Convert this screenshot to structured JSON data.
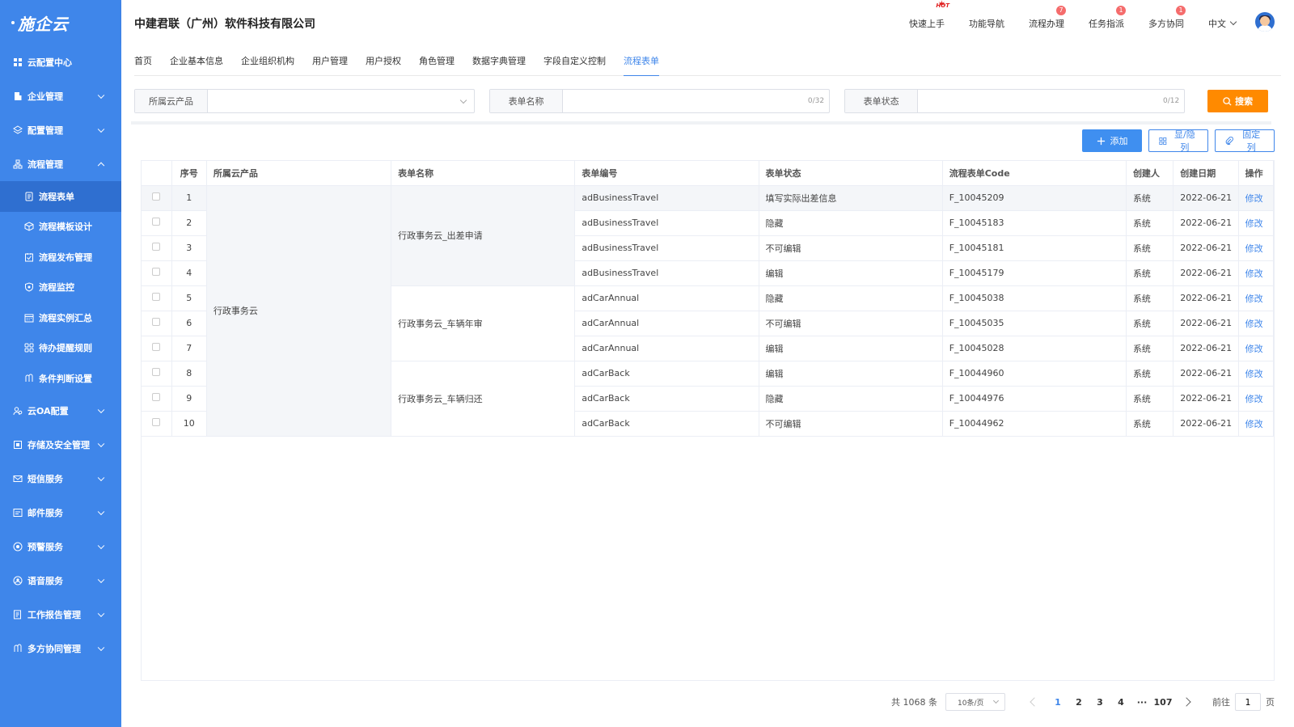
{
  "brand": {
    "logo": "施企云"
  },
  "sidebar": {
    "items": [
      {
        "label": "云配置中心",
        "icon": "grid-icon",
        "expandable": false
      },
      {
        "label": "企业管理",
        "icon": "building-icon",
        "expandable": true
      },
      {
        "label": "配置管理",
        "icon": "layers-icon",
        "expandable": true
      },
      {
        "label": "流程管理",
        "icon": "flow-icon",
        "expandable": true,
        "expanded": true
      },
      {
        "label": "云OA配置",
        "icon": "users-icon",
        "expandable": true
      },
      {
        "label": "存储及安全管理",
        "icon": "storage-icon",
        "expandable": true
      },
      {
        "label": "短信服务",
        "icon": "mail-icon",
        "expandable": true
      },
      {
        "label": "邮件服务",
        "icon": "inbox-icon",
        "expandable": true
      },
      {
        "label": "预警服务",
        "icon": "alert-icon",
        "expandable": true
      },
      {
        "label": "语音服务",
        "icon": "voice-icon",
        "expandable": true
      },
      {
        "label": "工作报告管理",
        "icon": "report-icon",
        "expandable": true
      },
      {
        "label": "多方协同管理",
        "icon": "collab-icon",
        "expandable": true
      }
    ],
    "submenu": [
      {
        "label": "流程表单",
        "icon": "form-icon",
        "active": true
      },
      {
        "label": "流程模板设计",
        "icon": "cube-icon"
      },
      {
        "label": "流程发布管理",
        "icon": "publish-icon"
      },
      {
        "label": "流程监控",
        "icon": "shield-icon"
      },
      {
        "label": "流程实例汇总",
        "icon": "calendar-icon"
      },
      {
        "label": "待办提醒规则",
        "icon": "apps-icon"
      },
      {
        "label": "条件判断设置",
        "icon": "condition-icon"
      }
    ]
  },
  "header": {
    "company": "中建君联（广州）软件科技有限公司",
    "nav": [
      {
        "label": "快速上手",
        "badge": "HOT"
      },
      {
        "label": "功能导航",
        "badge": ""
      },
      {
        "label": "流程办理",
        "badge": "7"
      },
      {
        "label": "任务指派",
        "badge": "1"
      },
      {
        "label": "多方协同",
        "badge": "1"
      }
    ],
    "language": "中文"
  },
  "tabs": [
    "首页",
    "企业基本信息",
    "企业组织机构",
    "用户管理",
    "用户授权",
    "角色管理",
    "数据字典管理",
    "字段自定义控制",
    "流程表单"
  ],
  "active_tab": "流程表单",
  "filter": {
    "product_label": "所属云产品",
    "product_value": "",
    "name_label": "表单名称",
    "name_value": "",
    "name_count": "0/32",
    "status_label": "表单状态",
    "status_value": "",
    "status_count": "0/12",
    "search_label": "搜索"
  },
  "toolbar": {
    "add_label": "添加",
    "toggle_cols_label": "显/隐列",
    "fix_cols_label": "固定列"
  },
  "table": {
    "columns": [
      "序号",
      "所属云产品",
      "表单名称",
      "表单编号",
      "表单状态",
      "流程表单Code",
      "创建人",
      "创建日期",
      "操作"
    ],
    "product": "行政事务云",
    "groups": [
      {
        "name": "行政事务云_出差申请",
        "rows": 4
      },
      {
        "name": "行政事务云_车辆年审",
        "rows": 3
      },
      {
        "name": "行政事务云_车辆归还",
        "rows": 3
      }
    ],
    "rows": [
      {
        "no": "1",
        "code": "adBusinessTravel",
        "status": "填写实际出差信息",
        "flow_code": "F_10045209",
        "creator": "系统",
        "date": "2022-06-21",
        "action": "修改"
      },
      {
        "no": "2",
        "code": "adBusinessTravel",
        "status": "隐藏",
        "flow_code": "F_10045183",
        "creator": "系统",
        "date": "2022-06-21",
        "action": "修改"
      },
      {
        "no": "3",
        "code": "adBusinessTravel",
        "status": "不可编辑",
        "flow_code": "F_10045181",
        "creator": "系统",
        "date": "2022-06-21",
        "action": "修改"
      },
      {
        "no": "4",
        "code": "adBusinessTravel",
        "status": "编辑",
        "flow_code": "F_10045179",
        "creator": "系统",
        "date": "2022-06-21",
        "action": "修改"
      },
      {
        "no": "5",
        "code": "adCarAnnual",
        "status": "隐藏",
        "flow_code": "F_10045038",
        "creator": "系统",
        "date": "2022-06-21",
        "action": "修改"
      },
      {
        "no": "6",
        "code": "adCarAnnual",
        "status": "不可编辑",
        "flow_code": "F_10045035",
        "creator": "系统",
        "date": "2022-06-21",
        "action": "修改"
      },
      {
        "no": "7",
        "code": "adCarAnnual",
        "status": "编辑",
        "flow_code": "F_10045028",
        "creator": "系统",
        "date": "2022-06-21",
        "action": "修改"
      },
      {
        "no": "8",
        "code": "adCarBack",
        "status": "编辑",
        "flow_code": "F_10044960",
        "creator": "系统",
        "date": "2022-06-21",
        "action": "修改"
      },
      {
        "no": "9",
        "code": "adCarBack",
        "status": "隐藏",
        "flow_code": "F_10044976",
        "creator": "系统",
        "date": "2022-06-21",
        "action": "修改"
      },
      {
        "no": "10",
        "code": "adCarBack",
        "status": "不可编辑",
        "flow_code": "F_10044962",
        "creator": "系统",
        "date": "2022-06-21",
        "action": "修改"
      }
    ]
  },
  "pagination": {
    "total": "共 1068 条",
    "page_size": "10条/页",
    "pages": [
      "1",
      "2",
      "3",
      "4"
    ],
    "ellipsis": "···",
    "last_page": "107",
    "current": "1",
    "goto_prefix": "前往",
    "goto_value": "1",
    "goto_suffix": "页"
  },
  "colors": {
    "sidebar": "#3f86ea",
    "primary": "#3f8ff0",
    "search": "#ff8a00",
    "badge": "#f56c6c"
  }
}
